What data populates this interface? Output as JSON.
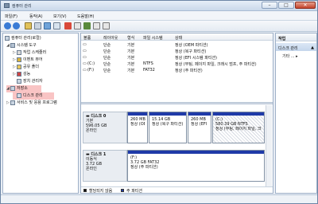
{
  "window": {
    "title": "컴퓨터 관리",
    "min_icon": "minimize-icon",
    "max_icon": "maximize-icon",
    "close_icon": "close-icon"
  },
  "menu": [
    "파일(F)",
    "동작(A)",
    "보기(V)",
    "도움말(H)"
  ],
  "tree": {
    "root": "컴퓨터 관리(로컬)",
    "system_tools": "시스템 도구",
    "task_scheduler": "작업 스케줄러",
    "event_viewer": "이벤트 뷰어",
    "shared_folders": "공유 폴더",
    "performance": "성능",
    "device_manager": "장치 관리자",
    "storage": "저장소",
    "disk_management": "디스크 관리",
    "services": "서비스 및 응용 프로그램"
  },
  "volume_list": {
    "headers": [
      "볼륨",
      "레이아웃",
      "형식",
      "파일 시스템",
      "상태"
    ],
    "rows": [
      {
        "volume": "",
        "layout": "단순",
        "type": "기본",
        "fs": "",
        "status": "정상 (OEM 파티션)"
      },
      {
        "volume": "",
        "layout": "단순",
        "type": "기본",
        "fs": "",
        "status": "정상 (복구 파티션)"
      },
      {
        "volume": "",
        "layout": "단순",
        "type": "기본",
        "fs": "",
        "status": "정상 (EFI 시스템 파티션)"
      },
      {
        "volume": "(C:)",
        "layout": "단순",
        "type": "기본",
        "fs": "NTFS",
        "status": "정상 (부팅, 페이지 파일, 크래시 덤프, 주 파티션)"
      },
      {
        "volume": "(F:)",
        "layout": "단순",
        "type": "기본",
        "fs": "FAT32",
        "status": "정상 (주 파티션)"
      }
    ]
  },
  "disks": [
    {
      "name": "디스크 0",
      "kind": "기본",
      "size": "596.05 GB",
      "state": "온라인",
      "partitions": [
        {
          "line1": "",
          "line2": "260 MB",
          "line3": "정상 (OEM 파티션)"
        },
        {
          "line1": "",
          "line2": "15.14 GB",
          "line3": "정상 (복구 파티션)"
        },
        {
          "line1": "",
          "line2": "260 MB",
          "line3": "정상 (EFI 시스템)"
        },
        {
          "line1": "(C:)",
          "line2": "580.39 GB NTFS",
          "line3": "정상 (부팅, 페이지 파일, 크래시)"
        }
      ]
    },
    {
      "name": "디스크 1",
      "kind": "이동식",
      "size": "3.72 GB",
      "state": "온라인",
      "partitions": [
        {
          "line1": "(F:)",
          "line2": "3.72 GB FAT32",
          "line3": "정상 (주 파티션)"
        }
      ]
    }
  ],
  "legend": [
    {
      "label": "할당되지 않음",
      "color": "#111111"
    },
    {
      "label": "주 파티션",
      "color": "#1f3aa8"
    }
  ],
  "actions": {
    "header": "작업",
    "section": "디스크 관리",
    "more": "기타 ..."
  }
}
